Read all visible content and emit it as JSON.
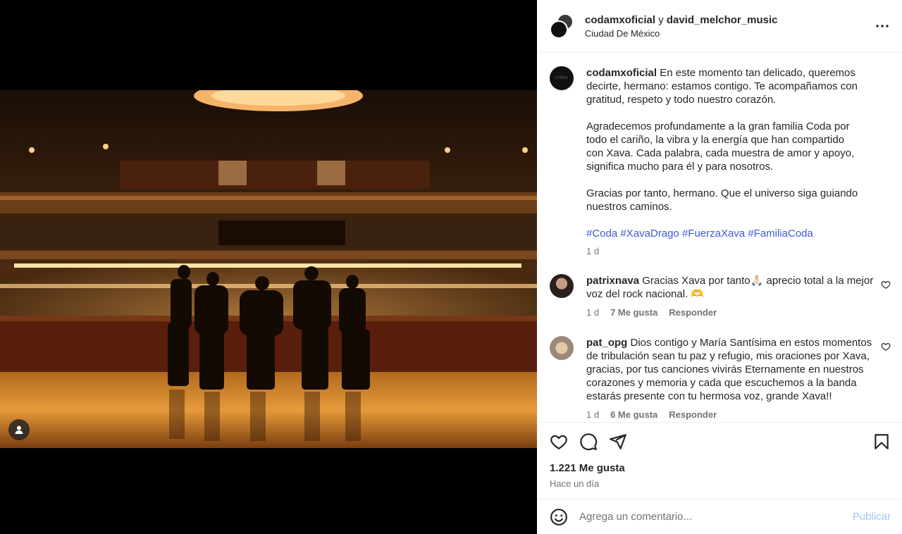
{
  "post": {
    "header": {
      "user1": "codamxoficial",
      "joiner": " y ",
      "user2": "david_melchor_music",
      "location": "Ciudad De México"
    },
    "caption": {
      "username": "codamxoficial",
      "para1": "En este momento tan delicado, queremos decirte, hermano: estamos contigo. Te acompañamos con gratitud, respeto y todo nuestro corazón.",
      "para2": "Agradecemos profundamente a la gran familia Coda por todo el cariño, la vibra y la energía que han compartido con Xava. Cada palabra, cada muestra de amor y apoyo, significa mucho para él y para nosotros.",
      "para3": "Gracias por tanto, hermano. Que el universo siga guiando nuestros caminos.",
      "hashtags": [
        "#Coda",
        "#XavaDrago",
        "#FuerzaXava",
        "#FamiliaCoda"
      ],
      "time": "1 d",
      "avatar_text": "CODA"
    },
    "comments": [
      {
        "username": "patrixnava",
        "text": "Gracias Xava por tanto🙏🏻 aprecio total a la mejor voz del rock nacional. 🫶",
        "time": "1 d",
        "likes": "7 Me gusta",
        "reply": "Responder"
      },
      {
        "username": "pat_opg",
        "text": "Dios contigo y María Santísima en estos momentos de tribulación sean tu paz y refugio, mis oraciones por Xava, gracias, por tus canciones vivirás Eternamente en nuestros corazones y memoria y cada que escuchemos a la banda estarás presente con tu hermosa voz, grande Xava!!",
        "time": "1 d",
        "likes": "6 Me gusta",
        "reply": "Responder"
      }
    ],
    "likes_count": "1.221 Me gusta",
    "posted": "Hace un día",
    "comment_input": {
      "placeholder": "Agrega un comentario...",
      "publish": "Publicar"
    }
  },
  "colors": {
    "hashtag": "#3b5bd6",
    "muted": "#737373",
    "publish": "#a3c4f3"
  },
  "icons": [
    "more-icon",
    "heart-icon",
    "comment-icon",
    "share-icon",
    "bookmark-icon",
    "emoji-icon",
    "user-tag-icon"
  ]
}
